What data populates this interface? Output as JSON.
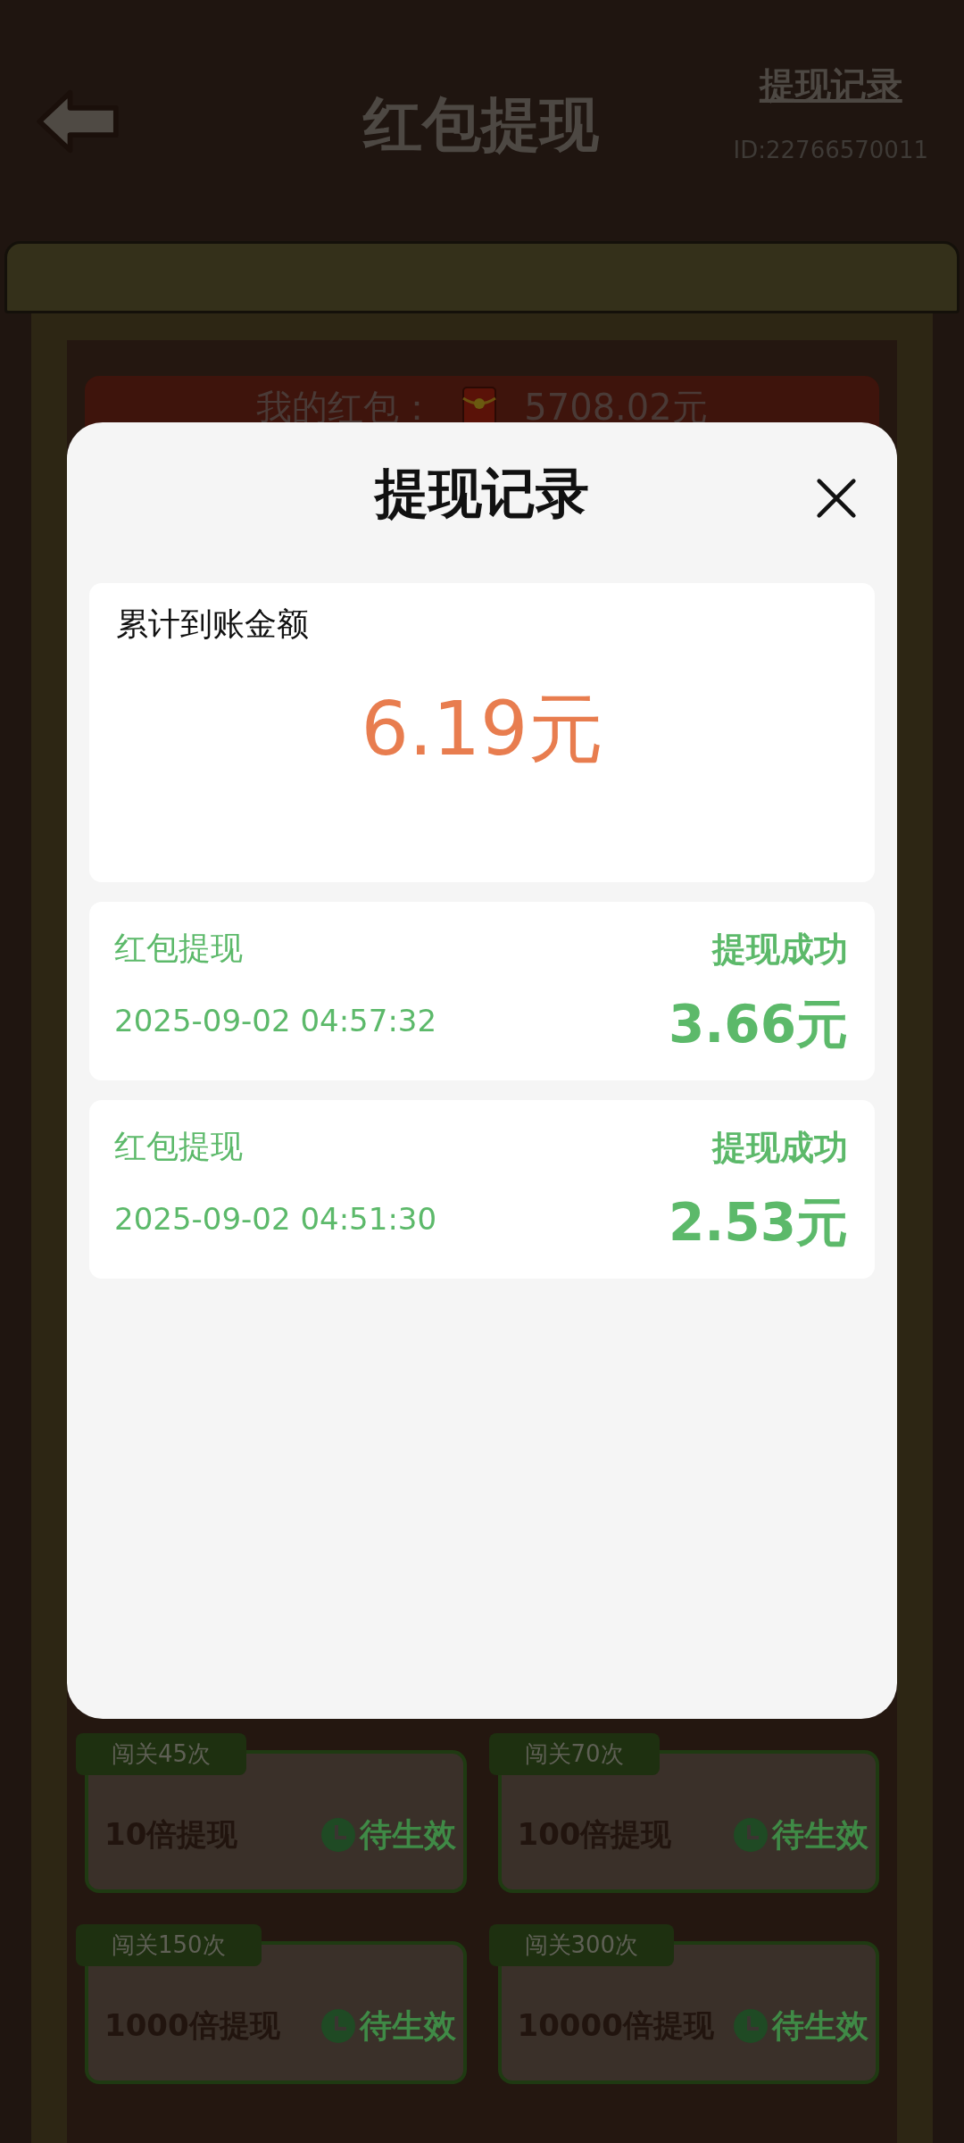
{
  "header": {
    "title": "红包提现",
    "records_link": "提现记录",
    "user_id": "ID:22766570011"
  },
  "balance_banner": {
    "label": "我的红包：",
    "amount": "5708.02元"
  },
  "tasks": [
    {
      "tag": "闯关45次",
      "title": "10倍提现",
      "status": "待生效"
    },
    {
      "tag": "闯关70次",
      "title": "100倍提现",
      "status": "待生效"
    },
    {
      "tag": "闯关150次",
      "title": "1000倍提现",
      "status": "待生效"
    },
    {
      "tag": "闯关300次",
      "title": "10000倍提现",
      "status": "待生效"
    }
  ],
  "dialog": {
    "title": "提现记录",
    "summary": {
      "label": "累计到账金额",
      "amount": "6.19元"
    },
    "records": [
      {
        "title": "红包提现",
        "status": "提现成功",
        "time": "2025-09-02 04:57:32",
        "amount": "3.66元"
      },
      {
        "title": "红包提现",
        "status": "提现成功",
        "time": "2025-09-02 04:51:30",
        "amount": "2.53元"
      }
    ]
  }
}
